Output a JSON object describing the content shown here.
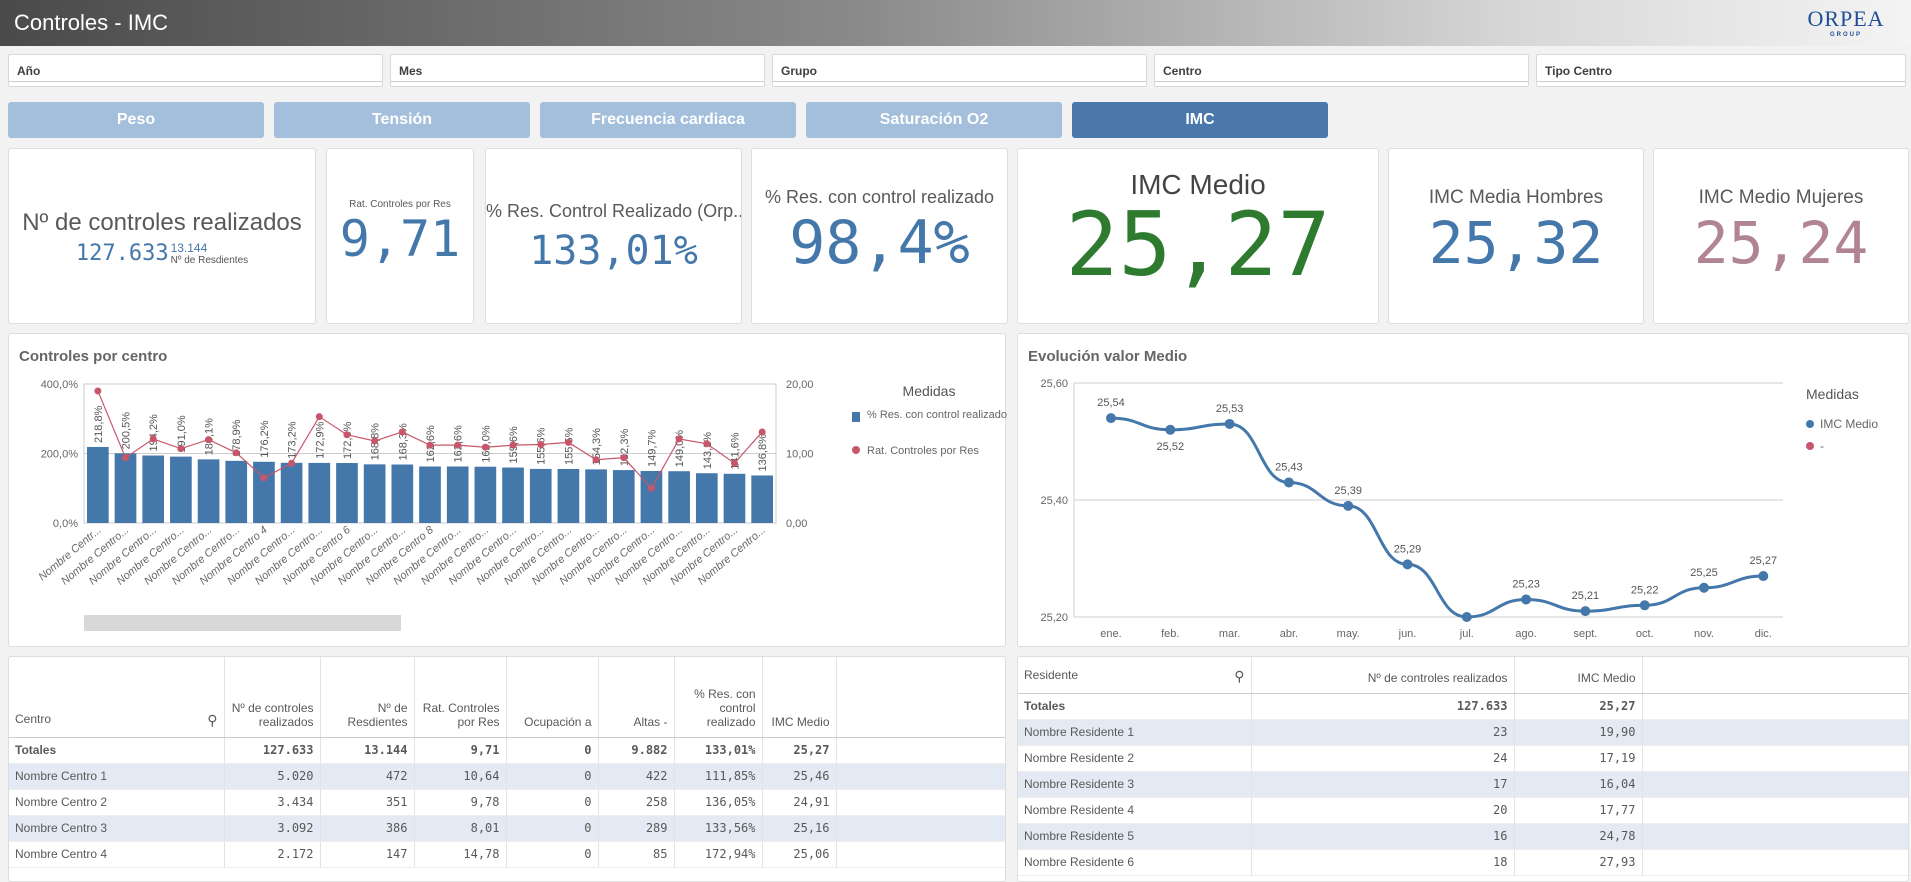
{
  "header": {
    "title": "Controles - IMC",
    "logo_text": "ORPEA",
    "logo_sub": "GROUP"
  },
  "filters": [
    "Año",
    "Mes",
    "Grupo",
    "Centro",
    "Tipo Centro"
  ],
  "tabs": [
    {
      "label": "Peso",
      "active": false
    },
    {
      "label": "Tensión",
      "active": false
    },
    {
      "label": "Frecuencia cardiaca",
      "active": false
    },
    {
      "label": "Saturación O2",
      "active": false
    },
    {
      "label": "IMC",
      "active": true
    }
  ],
  "kpis": {
    "controles": {
      "label": "Nº de controles realizados",
      "value": "127.633",
      "sub_value": "13.144",
      "sub_label": "Nº de Resdientes"
    },
    "ratio": {
      "label": "Rat. Controles por Res",
      "value": "9,71"
    },
    "pct_orp": {
      "label": "% Res. Control Realizado (Orp...",
      "value": "133,01%"
    },
    "pct": {
      "label": "% Res. con control realizado",
      "value": "98,4%"
    },
    "imc": {
      "label": "IMC Medio",
      "value": "25,27",
      "color": "#2e7a2e"
    },
    "imc_h": {
      "label": "IMC Media Hombres",
      "value": "25,32",
      "color": "#4477aa"
    },
    "imc_m": {
      "label": "IMC Medio Mujeres",
      "value": "25,24",
      "color": "#b08494"
    }
  },
  "chart_data": [
    {
      "type": "bar",
      "title": "Controles por centro",
      "categories": [
        "Nombre Centr...",
        "Nombre Centro...",
        "Nombre Centro...",
        "Nombre Centro...",
        "Nombre Centro...",
        "Nombre Centro...",
        "Nombre Centro 4",
        "Nombre Centro...",
        "Nombre Centro...",
        "Nombre Centro 6",
        "Nombre Centro...",
        "Nombre Centro...",
        "Nombre Centro 8",
        "Nombre Centro...",
        "Nombre Centro...",
        "Nombre Centro...",
        "Nombre Centro...",
        "Nombre Centro...",
        "Nombre Centro...",
        "Nombre Centro...",
        "Nombre Centro...",
        "Nombre Centro...",
        "Nombre Centro...",
        "Nombre Centro...",
        "Nombre Centro..."
      ],
      "legend_title": "Medidas",
      "legend_position": "right",
      "series": [
        {
          "name": "% Res. con control realizado",
          "type": "bar",
          "axis": "left",
          "color": "#4477aa",
          "values": [
            218.8,
            200.5,
            194.2,
            191.0,
            183.1,
            178.9,
            176.2,
            173.2,
            172.9,
            172.6,
            168.8,
            168.3,
            162.6,
            162.6,
            162.0,
            159.6,
            155.6,
            155.5,
            154.3,
            152.3,
            149.7,
            149.0,
            143.2,
            141.6,
            136.8
          ],
          "labels": [
            "218,8%",
            "200,5%",
            "194,2%",
            "191,0%",
            "183,1%",
            "178,9%",
            "176,2%",
            "173,2%",
            "172,9%",
            "172,6%",
            "168,8%",
            "168,3%",
            "162,6%",
            "162,6%",
            "162,0%",
            "159,6%",
            "155,6%",
            "155,5%",
            "154,3%",
            "152,3%",
            "149,7%",
            "149,0%",
            "143,2%",
            "141,6%",
            "136,8%"
          ]
        },
        {
          "name": "Rat. Controles por Res",
          "type": "line",
          "axis": "right",
          "color": "#c8566b",
          "values": [
            19.0,
            9.4,
            12.1,
            10.7,
            12.0,
            10.1,
            6.5,
            8.6,
            15.3,
            12.7,
            11.8,
            13.1,
            11.2,
            11.2,
            10.9,
            11.2,
            11.3,
            11.6,
            9.1,
            9.4,
            5.0,
            12.1,
            11.4,
            8.6,
            13.1
          ]
        }
      ],
      "y_left": {
        "range": [
          0,
          400
        ],
        "ticks": [
          "0,0%",
          "200,0%",
          "400,0%"
        ]
      },
      "y_right": {
        "range": [
          0,
          20
        ],
        "ticks": [
          "0,00",
          "10,00",
          "20,00"
        ]
      },
      "grid": true
    },
    {
      "type": "line",
      "title": "Evolución valor Medio",
      "categories": [
        "ene.",
        "feb.",
        "mar.",
        "abr.",
        "may.",
        "jun.",
        "jul.",
        "ago.",
        "sept.",
        "oct.",
        "nov.",
        "dic."
      ],
      "legend_title": "Medidas",
      "legend_position": "right",
      "series": [
        {
          "name": "IMC Medio",
          "color": "#4477aa",
          "values": [
            25.54,
            25.52,
            25.53,
            25.43,
            25.39,
            25.29,
            25.2,
            25.23,
            25.21,
            25.22,
            25.25,
            25.27
          ],
          "labels": [
            "25,54",
            "25,52",
            "25,53",
            "25,43",
            "25,39",
            "25,29",
            "",
            "25,23",
            "25,21",
            "25,22",
            "25,25",
            "25,27"
          ]
        },
        {
          "name": "-",
          "color": "#c8566b",
          "values": []
        }
      ],
      "y": {
        "range": [
          25.2,
          25.6
        ],
        "ticks": [
          "25,20",
          "25,40",
          "25,60"
        ]
      },
      "grid": true
    }
  ],
  "centros_table": {
    "headers": [
      "Centro",
      "Nº de controles realizados",
      "Nº de Resdientes",
      "Rat. Controles por Res",
      "Ocupación a",
      "Altas -",
      "% Res. con control realizado",
      "IMC Medio"
    ],
    "totals": [
      "Totales",
      "127.633",
      "13.144",
      "9,71",
      "0",
      "9.882",
      "133,01%",
      "25,27"
    ],
    "rows": [
      [
        "Nombre Centro 1",
        "5.020",
        "472",
        "10,64",
        "0",
        "422",
        "111,85%",
        "25,46"
      ],
      [
        "Nombre Centro 2",
        "3.434",
        "351",
        "9,78",
        "0",
        "258",
        "136,05%",
        "24,91"
      ],
      [
        "Nombre Centro 3",
        "3.092",
        "386",
        "8,01",
        "0",
        "289",
        "133,56%",
        "25,16"
      ],
      [
        "Nombre Centro 4",
        "2.172",
        "147",
        "14,78",
        "0",
        "85",
        "172,94%",
        "25,06"
      ]
    ]
  },
  "residentes_table": {
    "headers": [
      "Residente",
      "Nº de controles realizados",
      "IMC Medio"
    ],
    "totals": [
      "Totales",
      "127.633",
      "25,27"
    ],
    "rows": [
      [
        "Nombre Residente 1",
        "23",
        "19,90"
      ],
      [
        "Nombre Residente 2",
        "24",
        "17,19"
      ],
      [
        "Nombre Residente 3",
        "17",
        "16,04"
      ],
      [
        "Nombre Residente 4",
        "20",
        "17,77"
      ],
      [
        "Nombre Residente 5",
        "16",
        "24,78"
      ],
      [
        "Nombre Residente 6",
        "18",
        "27,93"
      ]
    ]
  }
}
